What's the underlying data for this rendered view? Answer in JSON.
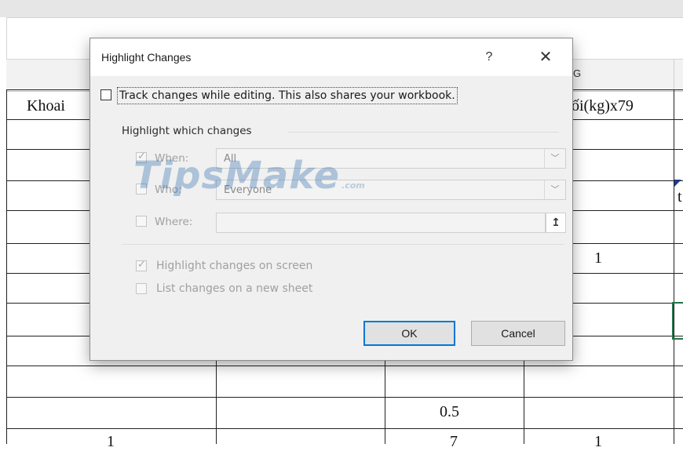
{
  "spreadsheet": {
    "column_g_header": "G",
    "cells": {
      "khoai": "Khoai",
      "header_partial": "ối(kg)x79",
      "t_partial": "t",
      "value_1": "1",
      "value_0_5": "0.5",
      "bottom_1_left": "1",
      "bottom_7": "7",
      "bottom_1_right": "1"
    }
  },
  "dialog": {
    "title": "Highlight Changes",
    "help_label": "?",
    "close_label": "✕",
    "track_changes_label": "Track changes while editing. This also shares your workbook.",
    "track_changes_checked": false,
    "group_title": "Highlight which changes",
    "when": {
      "label": "When:",
      "checked": true,
      "value": "All"
    },
    "who": {
      "label": "Who:",
      "checked": false,
      "value": "Everyone"
    },
    "where": {
      "label": "Where:",
      "checked": false,
      "value": ""
    },
    "highlight_on_screen": {
      "label": "Highlight changes on screen",
      "checked": true
    },
    "list_on_new_sheet": {
      "label": "List changes on a new sheet",
      "checked": false
    },
    "ok_label": "OK",
    "cancel_label": "Cancel",
    "collapse_icon": "↥",
    "dropdown_icon": "﹀"
  },
  "watermark": {
    "main": "TipsMake",
    "sub": ".com"
  },
  "colors": {
    "ok_focus": "#0078d7",
    "dialog_bg": "#f0f0f0",
    "watermark": "#2e6cae",
    "selection": "#217346"
  }
}
